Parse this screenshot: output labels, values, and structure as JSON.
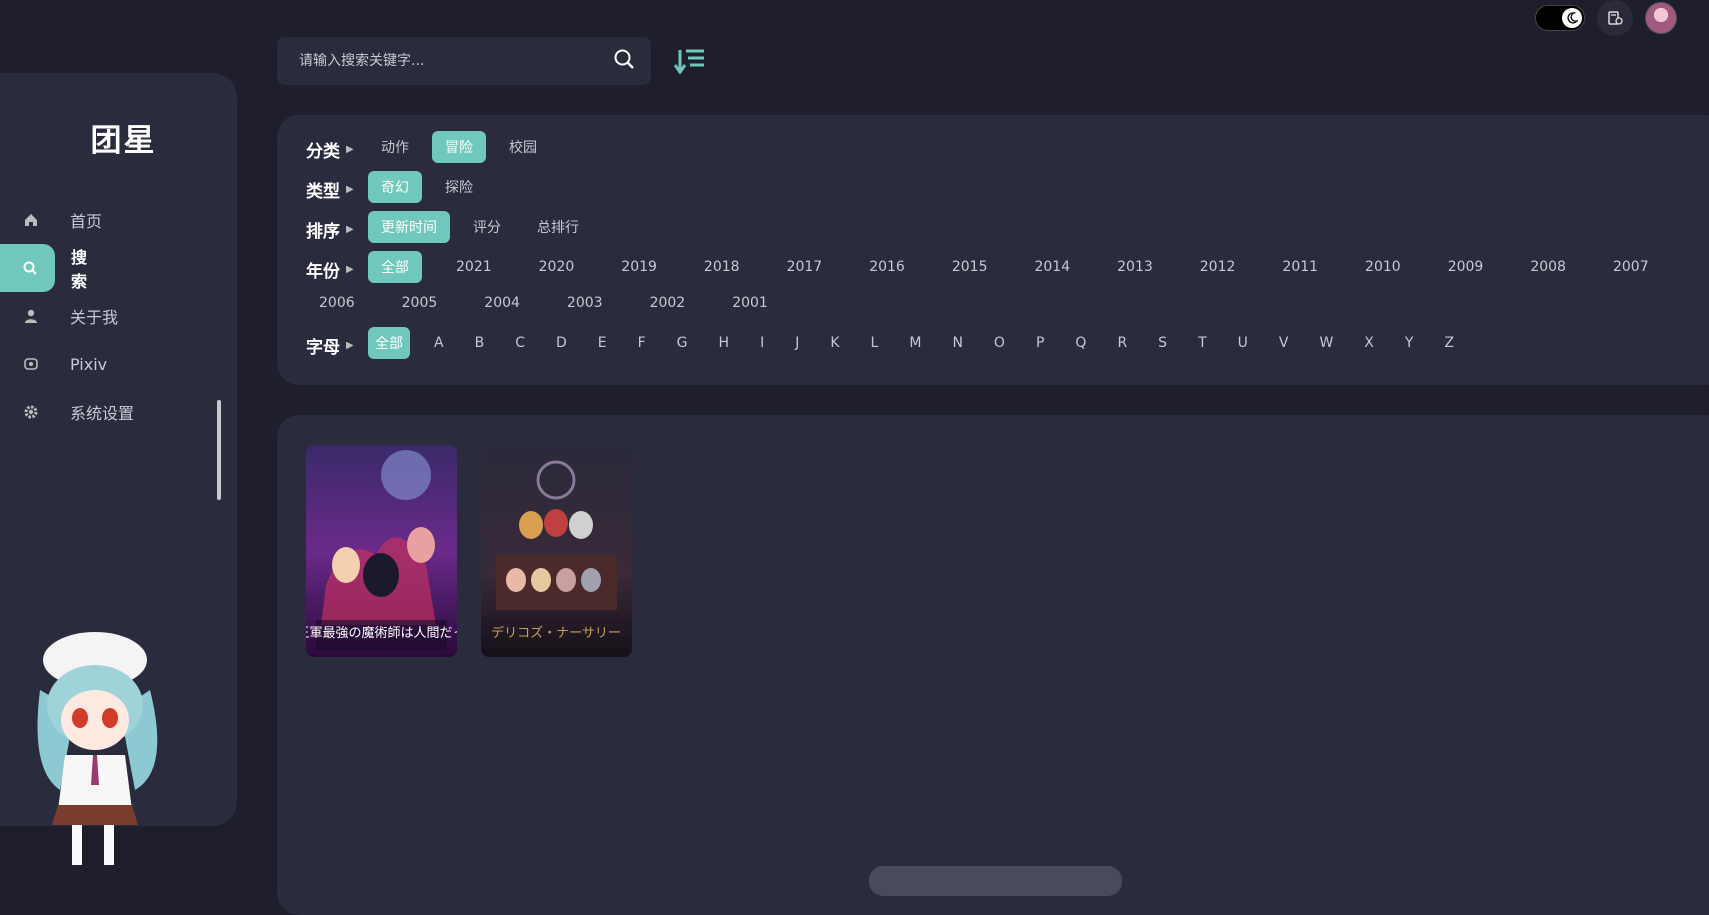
{
  "brand": {
    "title": "团星"
  },
  "nav": {
    "items": [
      {
        "label": "首页",
        "icon": "home-icon"
      },
      {
        "label": "搜索",
        "icon": "search-icon"
      },
      {
        "label": "关于我",
        "icon": "user-icon"
      },
      {
        "label": "Pixiv",
        "icon": "pixiv-icon"
      },
      {
        "label": "系统设置",
        "icon": "gear-icon"
      }
    ],
    "active": "搜索"
  },
  "search": {
    "placeholder": "请输入搜索关键字..."
  },
  "filters": {
    "category": {
      "label": "分类",
      "options": [
        "动作",
        "冒险",
        "校园"
      ],
      "selected": "冒险"
    },
    "type": {
      "label": "类型",
      "options": [
        "奇幻",
        "探险"
      ],
      "selected": "奇幻"
    },
    "sort": {
      "label": "排序",
      "options": [
        "更新时间",
        "评分",
        "总排行"
      ],
      "selected": "更新时间"
    },
    "year": {
      "label": "年份",
      "options": [
        "全部",
        "2021",
        "2020",
        "2019",
        "2018",
        "2017",
        "2016",
        "2015",
        "2014",
        "2013",
        "2012",
        "2011",
        "2010",
        "2009",
        "2008",
        "2007",
        "2006",
        "2005",
        "2004",
        "2003",
        "2002",
        "2001"
      ],
      "selected": "全部"
    },
    "letter": {
      "label": "字母",
      "options": [
        "全部",
        "A",
        "B",
        "C",
        "D",
        "E",
        "F",
        "G",
        "H",
        "I",
        "J",
        "K",
        "L",
        "M",
        "N",
        "O",
        "P",
        "Q",
        "R",
        "S",
        "T",
        "U",
        "V",
        "W",
        "X",
        "Y",
        "Z"
      ],
      "selected": "全部"
    }
  },
  "results": [
    {
      "poster_text": "魔王軍最強の魔術師は人間だった"
    },
    {
      "poster_text": "デリコズ・ナーサリー"
    }
  ],
  "colors": {
    "accent": "#6fc8bb",
    "bg": "#1e1e2c",
    "panel": "#2a2b3d"
  }
}
